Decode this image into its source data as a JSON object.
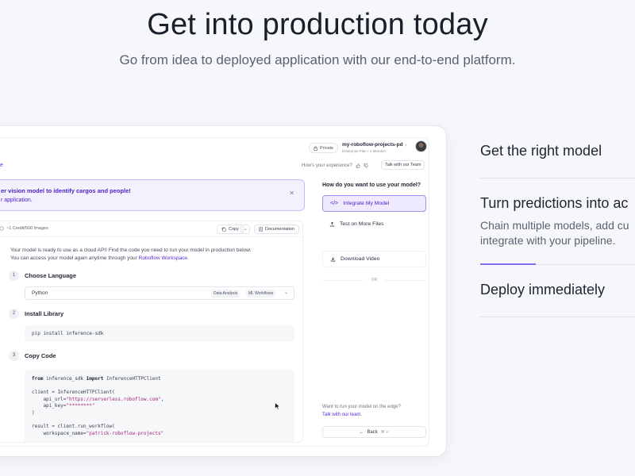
{
  "hero": {
    "title": "Get into production today",
    "subtitle": "Go from idea to deployed application with our end-to-end platform."
  },
  "app": {
    "topbar": {
      "private_label": "Private",
      "workspace_name": "my-roboflow-projects-pd",
      "workspace_plan": "Enterprise Plan • 1 Member",
      "avatar_icon": "user-avatar"
    },
    "subbar": {
      "left_label": "e",
      "feedback_label": "How's your experience?",
      "talk_button": "Talk with our Team"
    },
    "banner": {
      "title": "er vision model to identify cargos and people!",
      "description": "r application.",
      "close_icon": "close-icon"
    },
    "code_panel": {
      "credit_label": "~1 Credit/500 Images",
      "copy_button": "Copy",
      "docs_button": "Documentation",
      "intro_line1": "Your model is ready to use as a cloud API! Find the code you need to run your model in production below.",
      "intro_line2_prefix": "You can access your model again anytime through your ",
      "intro_line2_link": "Roboflow Workspace",
      "intro_line2_suffix": ".",
      "steps": [
        {
          "number": "1",
          "title": "Choose Language"
        },
        {
          "number": "2",
          "title": "Install Library"
        },
        {
          "number": "3",
          "title": "Copy Code"
        }
      ],
      "language": {
        "value": "Python",
        "tags": [
          "Data Analysis",
          "ML Workflows"
        ]
      },
      "install_command": "pip install inference-sdk",
      "code": {
        "l1_kw1": "from",
        "l1_mid": " inference_sdk ",
        "l1_kw2": "import",
        "l1_end": " InferenceHTTPClient",
        "l3": "client = InferenceHTTPClient(",
        "l4_pre": "    api_url=",
        "l4_str": "\"https://serverless.roboflow.com\"",
        "l4_post": ",",
        "l5_pre": "    api_key=",
        "l5_str": "\"********\"",
        "l6": ")",
        "l8": "result = client.run_workflow(",
        "l9_pre": "    workspace_name=",
        "l9_str": "\"patrick-roboflow-projects\""
      }
    },
    "right_panel": {
      "title": "How do you want to use your model?",
      "options": [
        {
          "label": "Integrate My Model",
          "icon": "code-icon",
          "active": true
        },
        {
          "label": "Test on More Files",
          "icon": "upload-icon",
          "active": false
        },
        {
          "label": "Download Video",
          "icon": "download-icon",
          "active": false
        }
      ],
      "or_label": "OR",
      "edge_question": "Want to run your model on the edge?",
      "edge_link": "Talk with our team.",
      "back_button": "Back",
      "back_shortcut": "⌘ ↵"
    }
  },
  "features": [
    {
      "title": "Get the right model",
      "description": ""
    },
    {
      "title": "Turn predictions into ac",
      "description_line1": "Chain multiple models, add cu",
      "description_line2": "integrate with your pipeline."
    },
    {
      "title": "Deploy immediately",
      "description": ""
    }
  ],
  "colors": {
    "accent": "#5a2bd6",
    "accent_soft": "#efeafd",
    "progress_accent": "#8b6cf0",
    "background": "#f6f7fb"
  }
}
